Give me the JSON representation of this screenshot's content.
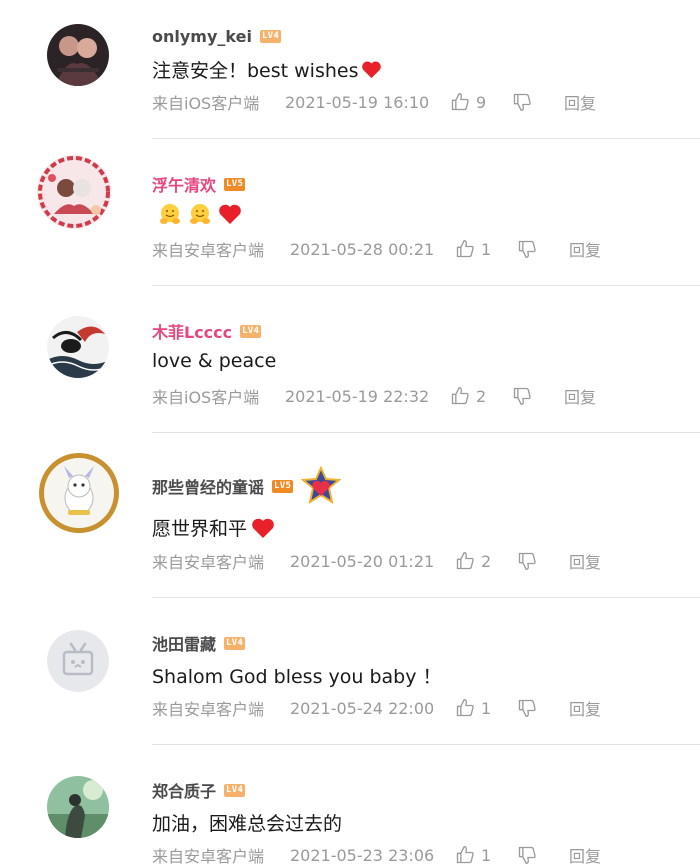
{
  "comments": [
    {
      "username": "onlymy_kei",
      "level": "LV4",
      "text": "注意安全！best wishes",
      "source": "来自iOS客户端",
      "time": "2021-05-19 16:10",
      "likes": "9",
      "reply": "回复"
    },
    {
      "username": "浮午清欢",
      "level": "LV5",
      "text": "",
      "source": "来自安卓客户端",
      "time": "2021-05-28 00:21",
      "likes": "1",
      "reply": "回复"
    },
    {
      "username": "木菲Lcccc",
      "level": "LV4",
      "text": "love & peace",
      "source": "来自iOS客户端",
      "time": "2021-05-19 22:32",
      "likes": "2",
      "reply": "回复"
    },
    {
      "username": "那些曾经的童谣",
      "level": "LV5",
      "text": "愿世界和平",
      "source": "来自安卓客户端",
      "time": "2021-05-20 01:21",
      "likes": "2",
      "reply": "回复"
    },
    {
      "username": "池田雷藏",
      "level": "LV4",
      "text": "Shalom God bless you baby ！",
      "source": "来自安卓客户端",
      "time": "2021-05-24 22:00",
      "likes": "1",
      "reply": "回复"
    },
    {
      "username": "郑合质子",
      "level": "LV4",
      "text": "加油，困难总会过去的",
      "source": "来自安卓客户端",
      "time": "2021-05-23 23:06",
      "likes": "1",
      "reply": "回复"
    }
  ],
  "colors": {
    "pink_name": "#e8467f",
    "dark_name": "#4a4a4a",
    "meta_gray": "#9a9a9a",
    "heart_red": "#e8202a",
    "lv4": "#f6b26b",
    "lv5": "#f08a24"
  },
  "icons": {
    "like": "thumbs-up-icon",
    "dislike": "thumbs-down-icon",
    "heart": "heart-emoji",
    "hug": "hug-emoji",
    "medal": "fan-medal-icon"
  }
}
